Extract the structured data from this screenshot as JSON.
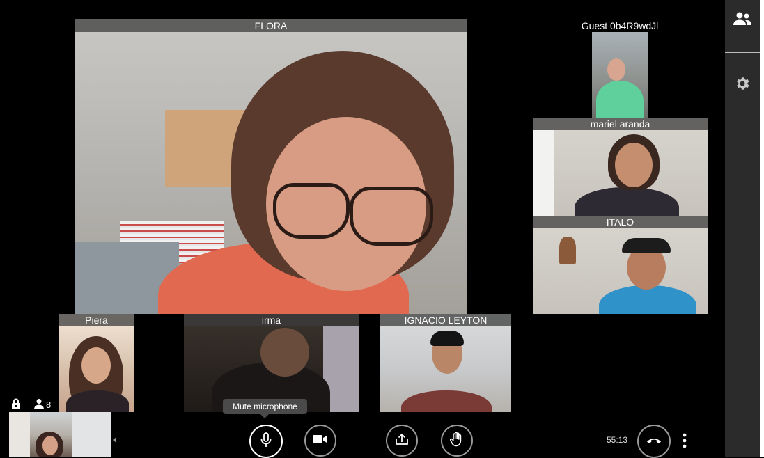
{
  "participants": {
    "main": {
      "name": "FLORA"
    },
    "guest": {
      "name": "Guest 0b4R9wdJl"
    },
    "mariel": {
      "name": "mariel aranda"
    },
    "italo": {
      "name": "ITALO"
    },
    "piera": {
      "name": "Piera"
    },
    "irma": {
      "name": "irma"
    },
    "ignacio": {
      "name": "IGNACIO LEYTON"
    }
  },
  "status": {
    "participant_count": "8"
  },
  "toolbar": {
    "tooltip": "Mute microphone",
    "timer": "55:13"
  },
  "icons": {
    "sidebar": [
      "participants-icon",
      "gear-icon"
    ],
    "toolbar": [
      "microphone-icon",
      "camera-icon",
      "share-screen-icon",
      "raise-hand-icon",
      "hangup-icon",
      "more-options-icon"
    ],
    "status": [
      "lock-icon",
      "person-icon"
    ]
  },
  "colors": {
    "background": "#000000",
    "sidebar": "#2b2b2b",
    "label_bar": "#3c3c3c"
  }
}
